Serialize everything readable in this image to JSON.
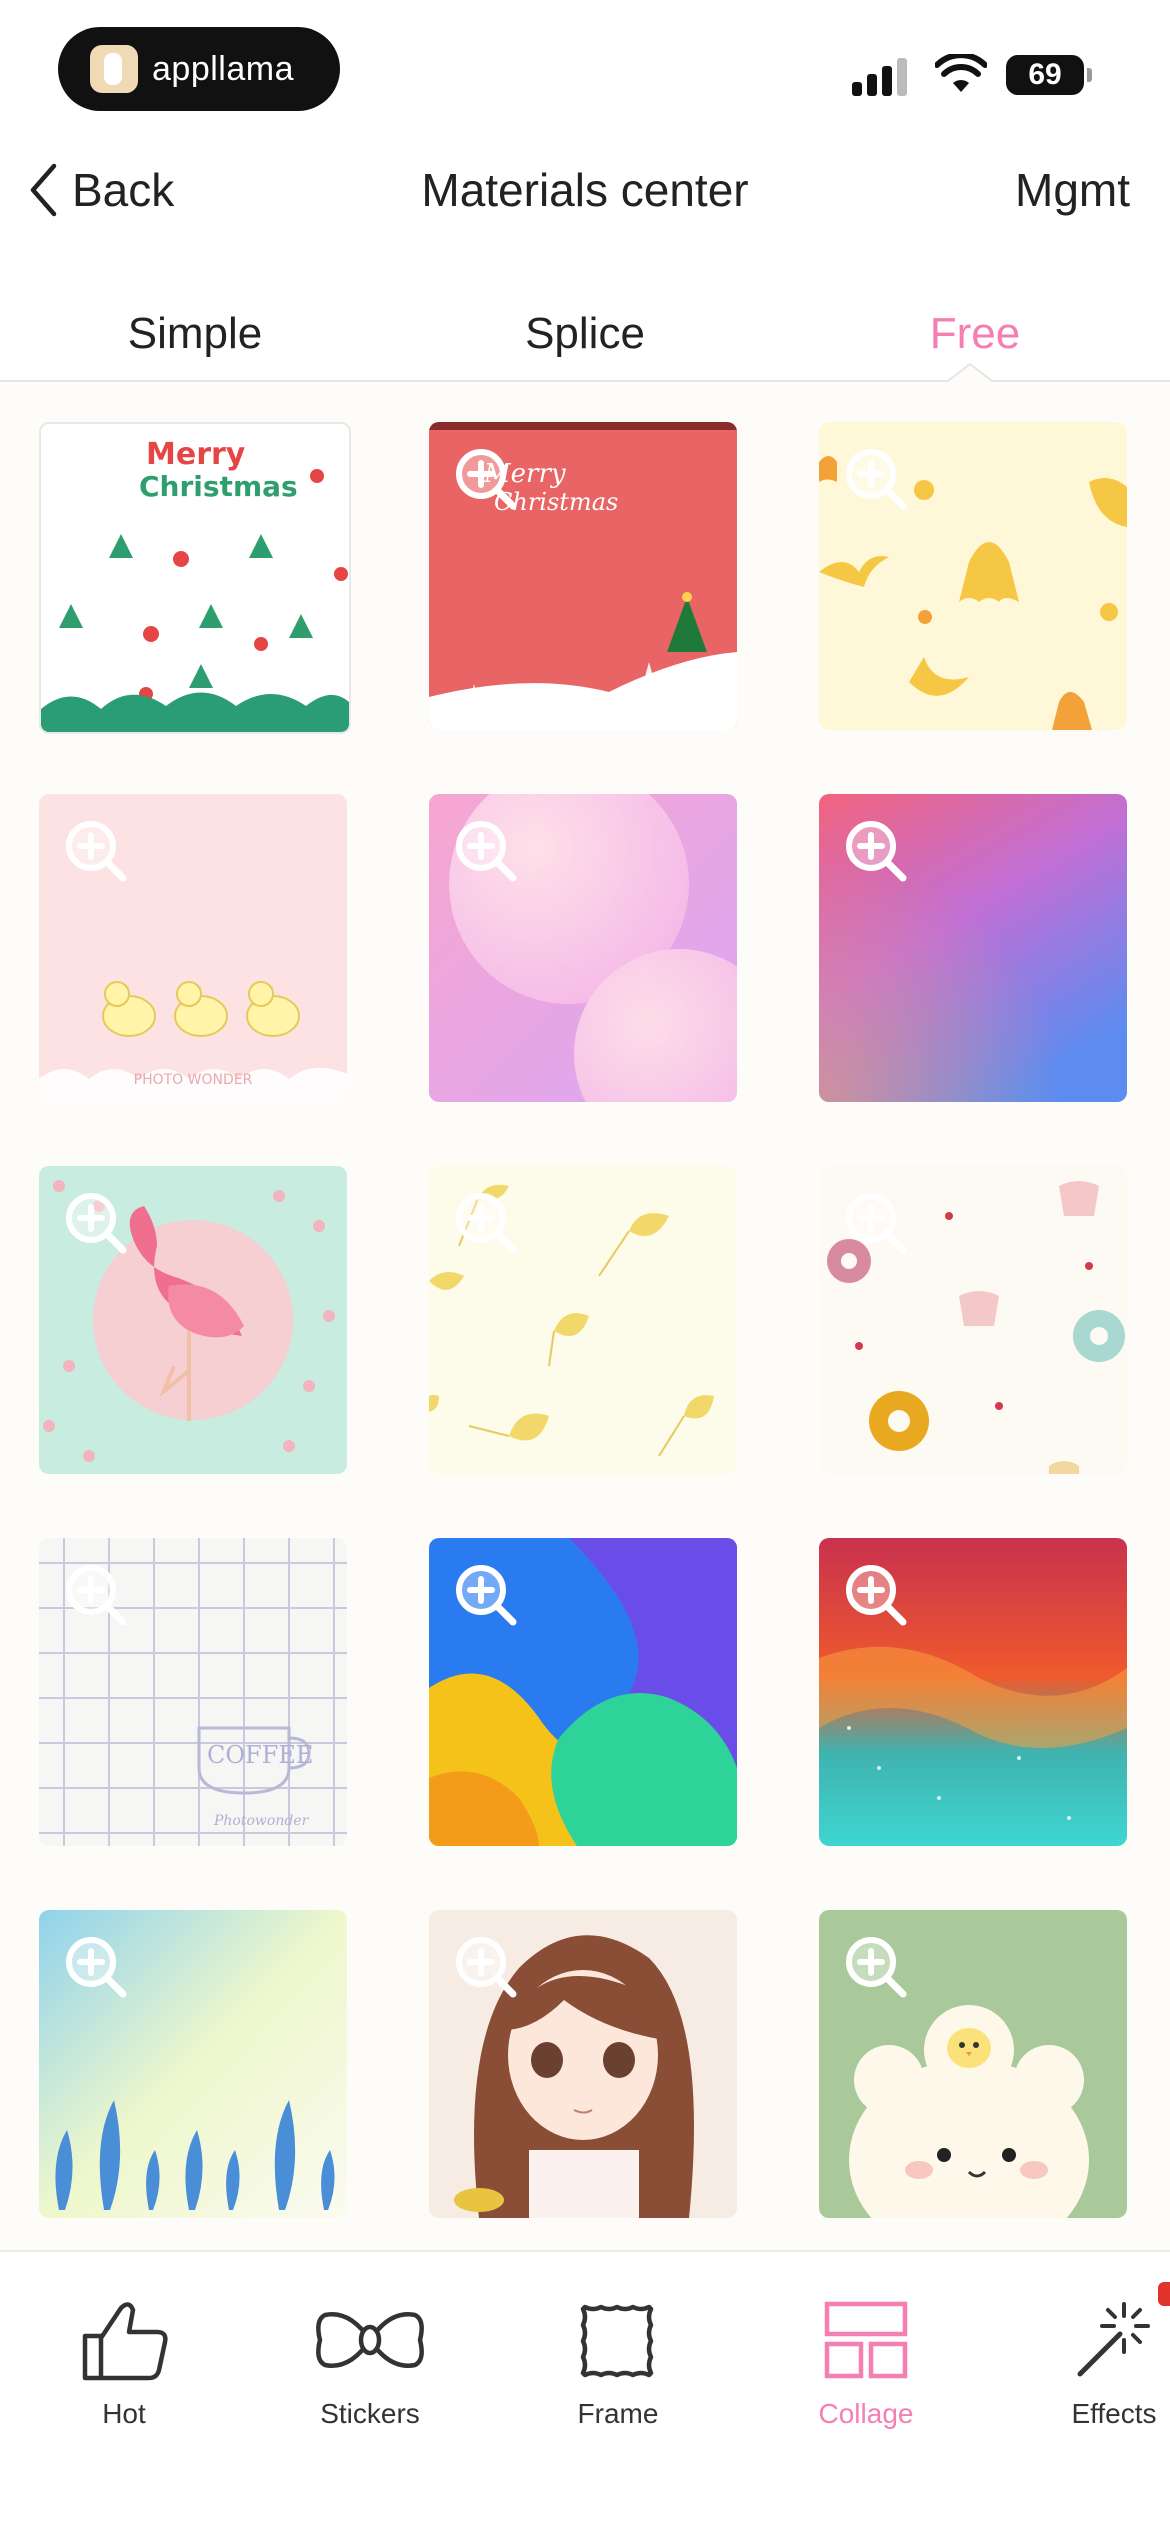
{
  "status_bar": {
    "app_name": "appllama",
    "battery": "69"
  },
  "nav": {
    "back_label": "Back",
    "title": "Materials center",
    "right_action": "Mgmt"
  },
  "tabs": [
    {
      "label": "Simple",
      "active": false
    },
    {
      "label": "Splice",
      "active": false
    },
    {
      "label": "Free",
      "active": true
    }
  ],
  "materials": [
    {
      "name": "christmas-pattern-white",
      "texts": [
        "Merry",
        "Christmas"
      ]
    },
    {
      "name": "christmas-card-red",
      "texts": [
        "Merry",
        "Christmas"
      ]
    },
    {
      "name": "halloween-pattern-yellow"
    },
    {
      "name": "ducks-pink",
      "texts": [
        "PHOTO WONDER"
      ]
    },
    {
      "name": "pink-bubbles-gradient"
    },
    {
      "name": "pink-blue-gradient"
    },
    {
      "name": "flamingo-mint"
    },
    {
      "name": "ginkgo-leaves-cream"
    },
    {
      "name": "donuts-cupcakes"
    },
    {
      "name": "coffee-grid",
      "texts": [
        "COFFEE",
        "Photowonder"
      ]
    },
    {
      "name": "colorful-waves"
    },
    {
      "name": "galaxy-nebula"
    },
    {
      "name": "watercolor-feathers"
    },
    {
      "name": "anime-girl-portrait"
    },
    {
      "name": "sheep-chick-green"
    }
  ],
  "bottom_nav": [
    {
      "label": "Hot",
      "icon": "thumbs-up-icon",
      "active": false
    },
    {
      "label": "Stickers",
      "icon": "bow-icon",
      "active": false
    },
    {
      "label": "Frame",
      "icon": "frame-icon",
      "active": false
    },
    {
      "label": "Collage",
      "icon": "collage-icon",
      "active": true
    },
    {
      "label": "Effects",
      "icon": "magic-wand-icon",
      "active": false
    }
  ],
  "colors": {
    "accent": "#f57eb3",
    "text": "#222222",
    "grid_background": "#fdfcf9"
  }
}
